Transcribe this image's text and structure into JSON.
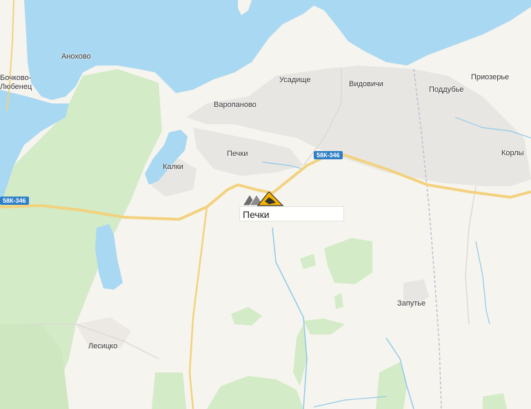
{
  "map": {
    "places": [
      {
        "id": "anokhovo",
        "name": "Анохово"
      },
      {
        "id": "bochkovo",
        "name": "Бочково-"
      },
      {
        "id": "lyubenets",
        "name": "Любенец"
      },
      {
        "id": "usadishche",
        "name": "Усадище"
      },
      {
        "id": "vidovichi",
        "name": "Видовичи"
      },
      {
        "id": "poddubye",
        "name": "Поддубье"
      },
      {
        "id": "priozerye",
        "name": "Приозерье"
      },
      {
        "id": "varopanovo",
        "name": "Варопаново"
      },
      {
        "id": "pechki",
        "name": "Печки"
      },
      {
        "id": "kalki",
        "name": "Калки"
      },
      {
        "id": "korly",
        "name": "Корлы"
      },
      {
        "id": "zaputye",
        "name": "Запутье"
      },
      {
        "id": "lesitsko",
        "name": "Лесицко"
      }
    ],
    "road_shields": [
      "58К-346",
      "58К-346"
    ],
    "selected_place": "Печки",
    "colors": {
      "water": "#a9d8f2",
      "land": "#f6f4ee",
      "forest": "#d3ebc6",
      "settlement": "#e8e6e3",
      "road": "#f6d98f",
      "shield": "#2f7fc6",
      "marker": "#f4b400"
    }
  }
}
